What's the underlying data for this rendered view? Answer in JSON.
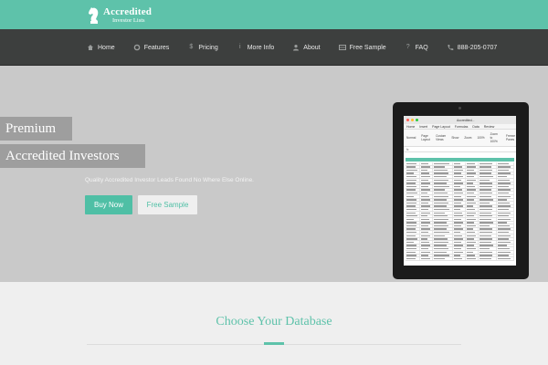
{
  "brand": {
    "name": "Accredited",
    "tagline": "Investor Lists",
    "color": "#5ec2aa"
  },
  "nav": {
    "items": [
      {
        "label": "Home",
        "icon": "home-icon"
      },
      {
        "label": "Features",
        "icon": "gear-icon"
      },
      {
        "label": "Pricing",
        "icon": "dollar-icon"
      },
      {
        "label": "More Info",
        "icon": "info-icon"
      },
      {
        "label": "About",
        "icon": "user-icon"
      },
      {
        "label": "Free Sample",
        "icon": "table-icon"
      },
      {
        "label": "FAQ",
        "icon": "question-icon"
      },
      {
        "label": "888-205-0707",
        "icon": "phone-icon"
      }
    ]
  },
  "hero": {
    "line1": "Premium",
    "line2": "Accredited Investors",
    "subtitle": "Quality Accredited Investor Leads Found No Where Else Online.",
    "buy_label": "Buy Now",
    "sample_label": "Free Sample"
  },
  "spreadsheet": {
    "doc_title": "Accredited...",
    "menu": [
      "Home",
      "Insert",
      "Page Layout",
      "Formulas",
      "Data",
      "Review"
    ],
    "ribbon": [
      "Normal",
      "Page Layout",
      "Custom Views",
      "Show",
      "Zoom",
      "100%",
      "Zoom to 100%",
      "Freeze Panes"
    ],
    "formula": "fx"
  },
  "section": {
    "title": "Choose Your Database"
  }
}
